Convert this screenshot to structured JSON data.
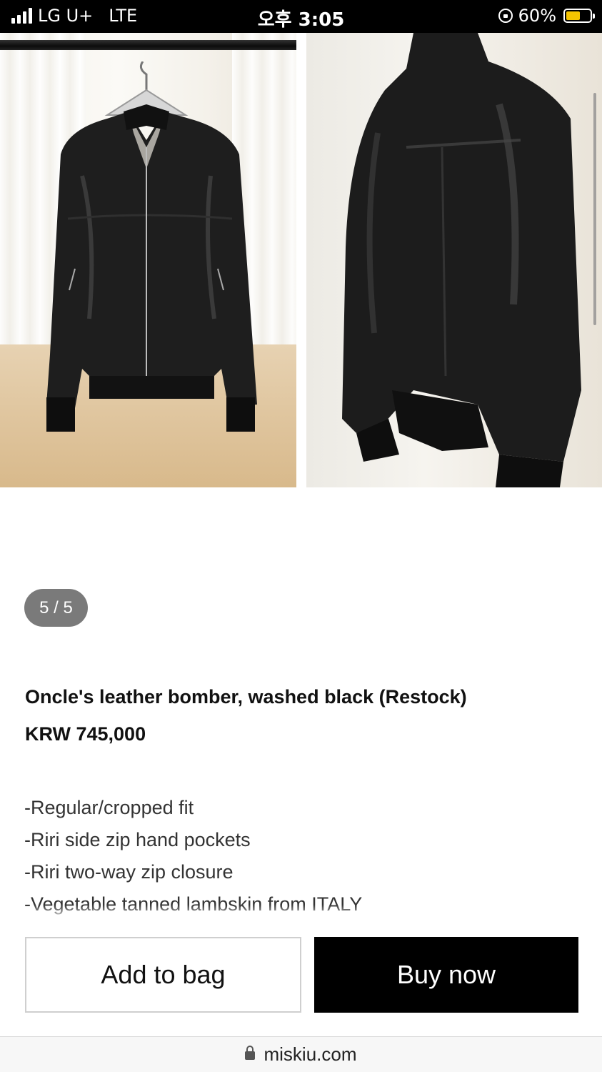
{
  "status_bar": {
    "carrier": "LG U+",
    "network": "LTE",
    "time": "오후 3:05",
    "battery_percent": "60%",
    "battery_level": 0.6,
    "battery_color": "#f5c400",
    "icons": [
      "signal-bars-icon",
      "rotation-lock-icon",
      "battery-icon"
    ]
  },
  "gallery": {
    "counter": "5 / 5",
    "current": 5,
    "total": 5,
    "images": [
      {
        "name": "jacket-front-hanging"
      },
      {
        "name": "jacket-back-view"
      }
    ]
  },
  "product": {
    "title": "Oncle's leather bomber, washed black (Restock)",
    "price": "KRW 745,000",
    "features": [
      "-Regular/cropped fit",
      "-Riri side zip hand pockets",
      "-Riri two-way zip closure",
      "-Vegetable tanned lambskin from ITALY"
    ]
  },
  "actions": {
    "add_to_bag": "Add to bag",
    "buy_now": "Buy now"
  },
  "browser": {
    "url": "miskiu.com",
    "icon": "padlock-icon"
  }
}
